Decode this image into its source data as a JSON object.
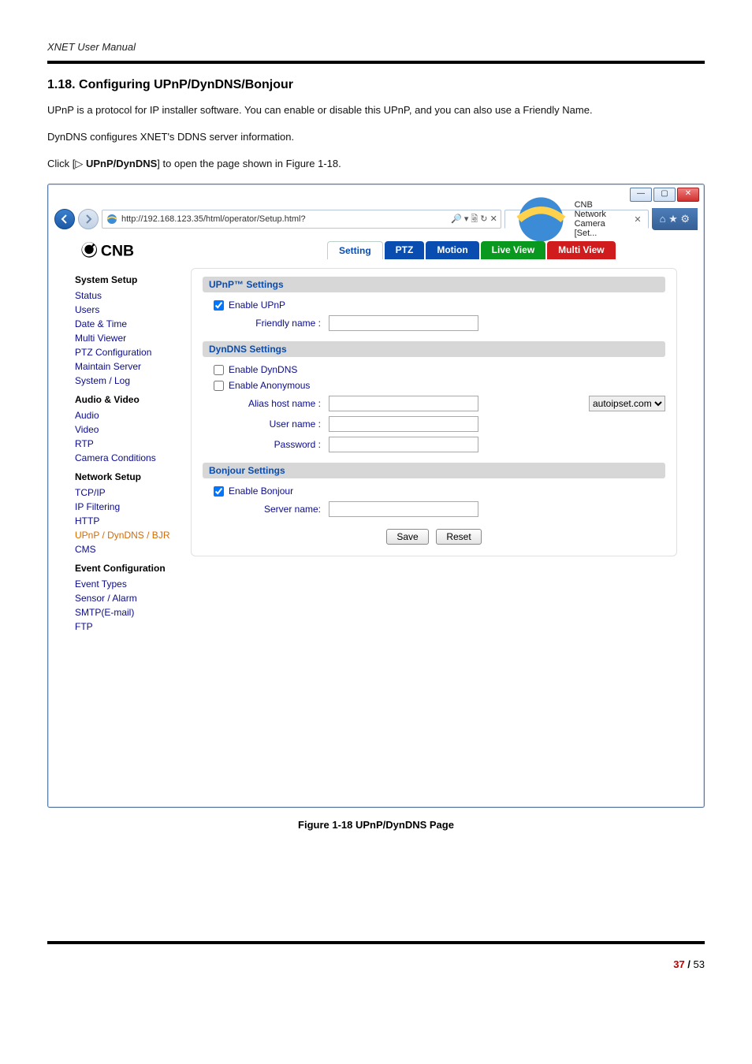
{
  "header": {
    "manual_title": "XNET User Manual"
  },
  "section": {
    "title": "1.18. Configuring UPnP/DynDNS/Bonjour"
  },
  "paragraphs": {
    "p1": "UPnP is a protocol for IP installer software. You can enable or disable this UPnP, and you can also use a Friendly Name.",
    "p2": "DynDNS configures XNET's DDNS server information.",
    "p3_pre": "Click [▷ ",
    "p3_bold": "UPnP/DynDNS",
    "p3_post": "] to open the page shown in Figure 1-18."
  },
  "browser": {
    "url": "http://192.168.123.35/html/operator/Setup.html?",
    "addr_tools": "🔎 ▾ 🗟 ↻ ✕",
    "tab_title": "CNB Network Camera [Set...",
    "tab_close": "✕",
    "win_min": "—",
    "win_max": "▢",
    "win_close": "✕",
    "toolbar_icons": "⌂ ★ ⚙"
  },
  "tabs": {
    "setting": "Setting",
    "ptz": "PTZ",
    "motion": "Motion",
    "live": "Live View",
    "multi": "Multi View"
  },
  "side": {
    "g1": "System Setup",
    "g1_items": [
      "Status",
      "Users",
      "Date & Time",
      "Multi Viewer",
      "PTZ Configuration",
      "Maintain Server",
      "System / Log"
    ],
    "g2": "Audio & Video",
    "g2_items": [
      "Audio",
      "Video",
      "RTP",
      "Camera Conditions"
    ],
    "g3": "Network Setup",
    "g3_items": [
      "TCP/IP",
      "IP Filtering",
      "HTTP",
      "UPnP / DynDNS / BJR",
      "CMS"
    ],
    "g4": "Event Configuration",
    "g4_items": [
      "Event Types",
      "Sensor / Alarm",
      "SMTP(E-mail)",
      "FTP"
    ]
  },
  "upnp": {
    "section": "UPnP™ Settings",
    "enable": "Enable UPnP",
    "friendly": "Friendly name :"
  },
  "dyn": {
    "section": "DynDNS Settings",
    "enable": "Enable DynDNS",
    "anon": "Enable Anonymous",
    "alias": "Alias host name :",
    "user": "User name :",
    "pass": "Password :",
    "domain": "autoipset.com"
  },
  "bonjour": {
    "section": "Bonjour Settings",
    "enable": "Enable Bonjour",
    "server": "Server name:"
  },
  "buttons": {
    "save": "Save",
    "reset": "Reset"
  },
  "figure": {
    "caption": "Figure 1-18 UPnP/DynDNS Page"
  },
  "footer": {
    "cur": "37",
    "sep": " / ",
    "total": "53"
  }
}
